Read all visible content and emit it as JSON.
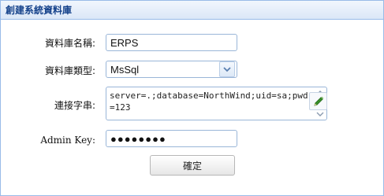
{
  "panel": {
    "title": "創建系統資料庫"
  },
  "form": {
    "db_name": {
      "label": "資料庫名稱:",
      "value": "ERPS"
    },
    "db_type": {
      "label": "資料庫類型:",
      "value": "MsSql"
    },
    "connection": {
      "label": "連接字串:",
      "value": "server=.;database=NorthWind;uid=sa;pwd=123"
    },
    "admin_key": {
      "label": "Admin Key:",
      "value": "●●●●●●●●"
    }
  },
  "buttons": {
    "confirm_label": "確定"
  },
  "colors": {
    "border": "#99bbe8",
    "title": "#15428b",
    "pencil": "#3a8f2a"
  }
}
